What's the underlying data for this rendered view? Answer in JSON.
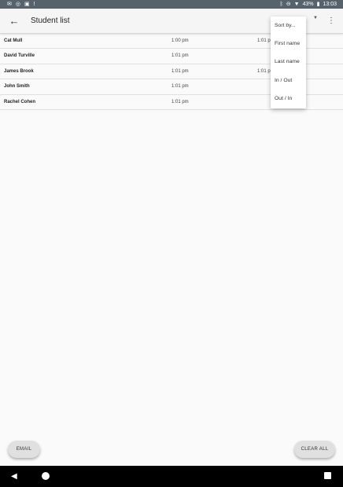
{
  "status_bar": {
    "time": "13:03",
    "battery": "43%",
    "icons_left": [
      "mail-icon",
      "sync-icon",
      "sim-icon",
      "alert-icon"
    ],
    "icons_right": [
      "bluetooth-icon",
      "do-not-disturb-icon",
      "wifi-icon",
      "battery-icon"
    ]
  },
  "app_bar": {
    "back_icon": "arrow-back-icon",
    "title": "Student list",
    "dropdown_icon": "dropdown-arrow-icon",
    "overflow_icon": "more-vert-icon"
  },
  "students": [
    {
      "name": "Cat Mull",
      "time_in": "1:00 pm",
      "time_out": "1:01 p"
    },
    {
      "name": "David Turville",
      "time_in": "1:01 pm",
      "time_out": ""
    },
    {
      "name": "James Brook",
      "time_in": "1:01 pm",
      "time_out": "1:01 p"
    },
    {
      "name": "John Smith",
      "time_in": "1:01 pm",
      "time_out": ""
    },
    {
      "name": "Rachel Cohen",
      "time_in": "1:01 pm",
      "time_out": ""
    }
  ],
  "sort_menu": {
    "items": [
      "Sort by...",
      "First name",
      "Last name",
      "In / Out",
      "Out / In"
    ]
  },
  "buttons": {
    "email": "EMAIL",
    "clear_all": "CLEAR ALL"
  },
  "nav_bar": {
    "icons": [
      "back-triangle-icon",
      "home-circle-icon",
      "recents-square-icon"
    ]
  },
  "colors": {
    "status_bar": "#57636c",
    "app_bar": "#f5f5f5",
    "background": "#fafafa",
    "button": "#e0e0e0",
    "nav_bar": "#000000"
  }
}
